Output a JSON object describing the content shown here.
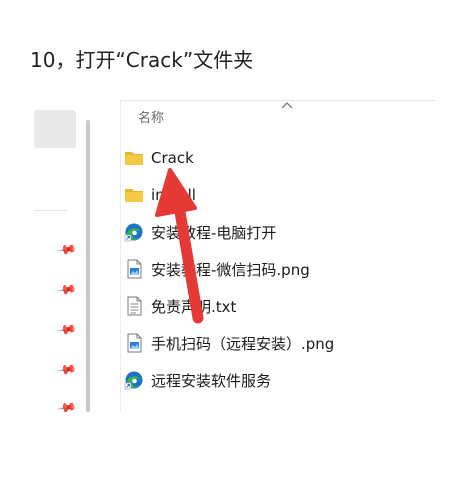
{
  "instruction": {
    "text": "10，打开“Crack”文件夹"
  },
  "explorer": {
    "column_header": "名称",
    "sort_indicator_icon": "chevron-up-icon",
    "files": [
      {
        "name": "Crack",
        "type": "folder",
        "icon": "folder-icon"
      },
      {
        "name": "install",
        "type": "folder",
        "icon": "folder-icon"
      },
      {
        "name": "安装教程-电脑打开",
        "type": "shortcut",
        "icon": "edge-browser-icon"
      },
      {
        "name": "安装教程-微信扫码.png",
        "type": "image",
        "icon": "image-file-icon"
      },
      {
        "name": "免责声明.txt",
        "type": "text",
        "icon": "text-file-icon"
      },
      {
        "name": "手机扫码（远程安装）.png",
        "type": "image",
        "icon": "image-file-icon"
      },
      {
        "name": "远程安装软件服务",
        "type": "shortcut",
        "icon": "edge-browser-icon"
      }
    ]
  },
  "colors": {
    "folder": "#f4c542",
    "arrow": "#e53935",
    "edge_blue": "#1a73c8",
    "edge_green": "#37b24d"
  }
}
